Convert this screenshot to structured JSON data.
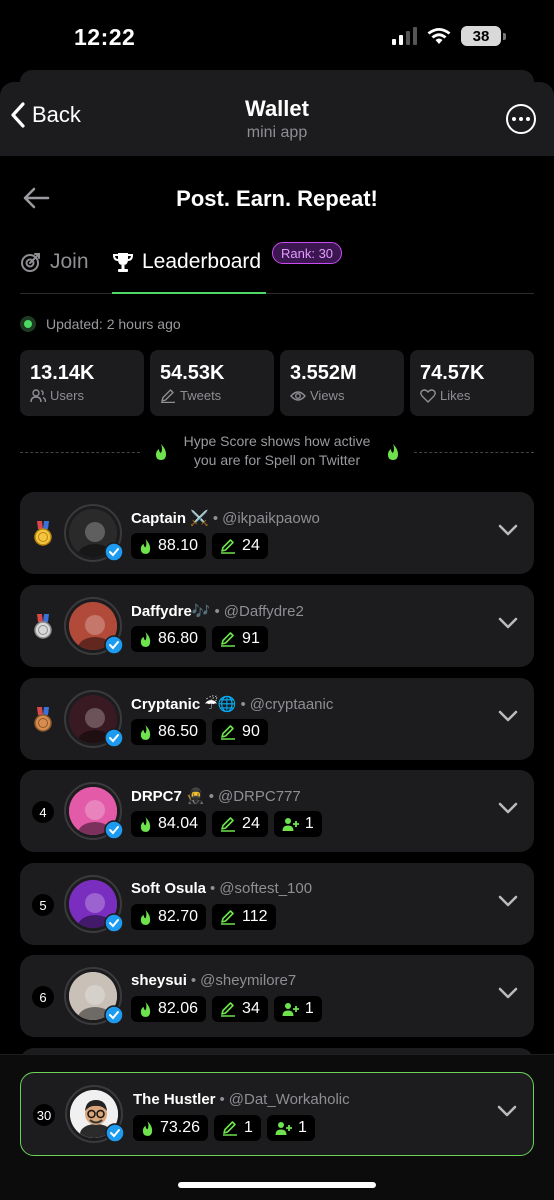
{
  "status_bar": {
    "time": "12:22",
    "battery": "38"
  },
  "header": {
    "back_label": "Back",
    "title": "Wallet",
    "subtitle": "mini app"
  },
  "page": {
    "title": "Post. Earn. Repeat!"
  },
  "tabs": {
    "join": "Join",
    "leaderboard": "Leaderboard",
    "rank_badge": "Rank: 30"
  },
  "updated": "Updated: 2 hours ago",
  "stats": [
    {
      "value": "13.14K",
      "label": "Users",
      "icon": "users-icon"
    },
    {
      "value": "54.53K",
      "label": "Tweets",
      "icon": "pen-icon"
    },
    {
      "value": "3.552M",
      "label": "Views",
      "icon": "eye-icon"
    },
    {
      "value": "74.57K",
      "label": "Likes",
      "icon": "heart-icon"
    }
  ],
  "hype_note": {
    "line1": "Hype Score shows how active",
    "line2": "you are for Spell on Twitter"
  },
  "leaderboard": [
    {
      "rank": "1",
      "medal": "gold",
      "name": "Captain ⚔️",
      "handle": "@ikpaikpaowo",
      "score": "88.10",
      "tweets": "24",
      "refs": "",
      "avatar_color": "#2a2a2a"
    },
    {
      "rank": "2",
      "medal": "silver",
      "name": "Daffydre🎶",
      "handle": "@Daffydre2",
      "score": "86.80",
      "tweets": "91",
      "refs": "",
      "avatar_color": "#b24a3a"
    },
    {
      "rank": "3",
      "medal": "bronze",
      "name": "Cryptanic ☔🌐",
      "handle": "@cryptaanic",
      "score": "86.50",
      "tweets": "90",
      "refs": "",
      "avatar_color": "#3a1a22"
    },
    {
      "rank": "4",
      "medal": "",
      "name": "DRPC7 🥷",
      "handle": "@DRPC777",
      "score": "84.04",
      "tweets": "24",
      "refs": "1",
      "avatar_color": "#e25aa8"
    },
    {
      "rank": "5",
      "medal": "",
      "name": "Soft Osula",
      "handle": "@softest_100",
      "score": "82.70",
      "tweets": "112",
      "refs": "",
      "avatar_color": "#7a2ec0"
    },
    {
      "rank": "6",
      "medal": "",
      "name": "sheysui",
      "handle": "@sheymilore7",
      "score": "82.06",
      "tweets": "34",
      "refs": "1",
      "avatar_color": "#c9c1b8"
    }
  ],
  "me": {
    "rank": "30",
    "name": "The Hustler",
    "handle": "@Dat_Workaholic",
    "score": "73.26",
    "tweets": "1",
    "refs": "1"
  },
  "colors": {
    "accent": "#4cd964",
    "badge_purple": "#c84bf0",
    "card": "#1c1c1e"
  }
}
